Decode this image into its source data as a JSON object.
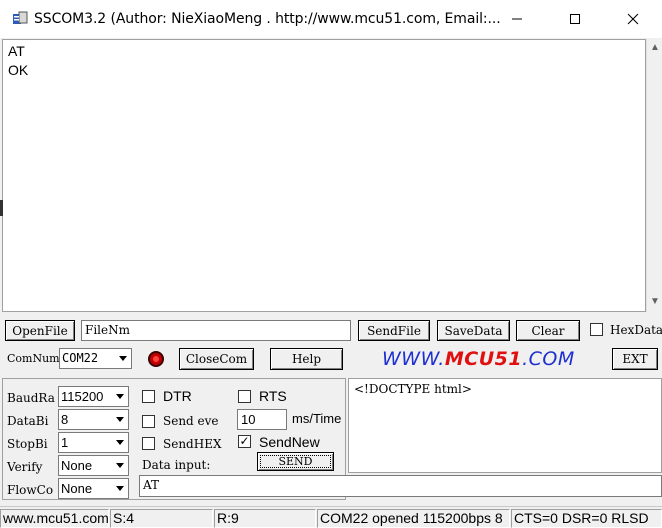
{
  "window": {
    "title": "SSCOM3.2 (Author: NieXiaoMeng .  http://www.mcu51.com,  Email:..."
  },
  "receive": {
    "text": "AT\nOK"
  },
  "file_row": {
    "open_file": "OpenFile",
    "file_name": "FileNm",
    "send_file": "SendFile",
    "save_data": "SaveData",
    "clear": "Clear",
    "hex_display": "HexData"
  },
  "com_row": {
    "com_num_label": "ComNum",
    "com_port": "COM22",
    "close_com": "CloseCom",
    "help": "Help",
    "logo_prefix": "WWW.",
    "logo_brand": "MCU51",
    "logo_suffix": ".COM",
    "ext": "EXT"
  },
  "settings": {
    "baud_label": "BaudRa",
    "baud_value": "115200",
    "databits_label": "DataBi",
    "databits_value": "8",
    "stopbits_label": "StopBi",
    "stopbits_value": "1",
    "verify_label": "Verify",
    "verify_value": "None",
    "flowctrl_label": "FlowCo",
    "flowctrl_value": "None"
  },
  "options": {
    "dtr": "DTR",
    "rts": "RTS",
    "send_every": "Send eve",
    "interval": "10",
    "interval_unit": "ms/Time",
    "send_hex": "SendHEX",
    "send_new": "SendNew",
    "data_input_label": "Data input:",
    "send_button": "SEND",
    "data_input_value": "AT"
  },
  "send_area": {
    "text": "<!DOCTYPE html>"
  },
  "status_bar": {
    "website": "www.mcu51.com",
    "sent": "S:4",
    "received": "R:9",
    "port_status": "COM22 opened 115200bps 8",
    "line_status": "CTS=0 DSR=0 RLSD"
  },
  "colors": {
    "logo_blue": "#1e2fd0",
    "logo_red": "#e01010"
  }
}
